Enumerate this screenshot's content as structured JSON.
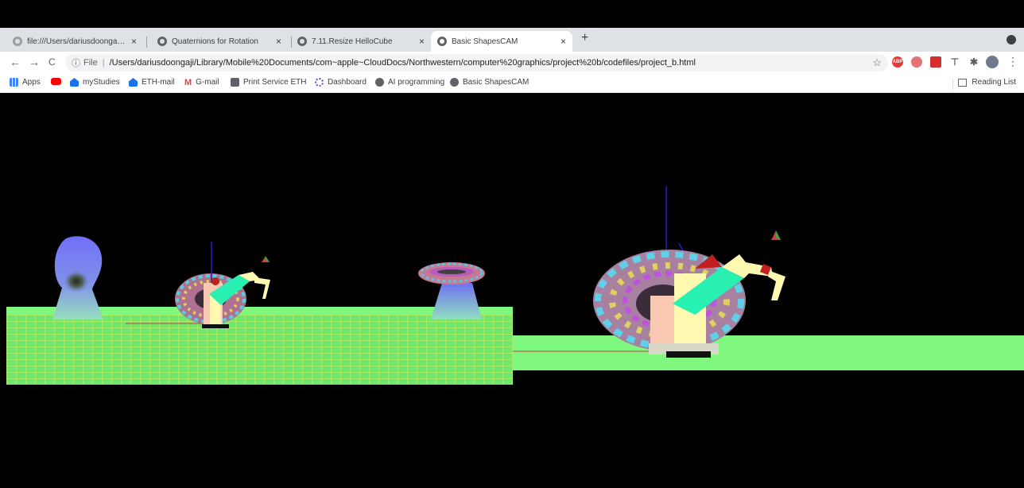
{
  "tabs": [
    {
      "label": "file:///Users/dariusdoongaji/Libr",
      "icon": "file-icon"
    },
    {
      "label": "Quaternions for Rotation",
      "icon": "globe-icon"
    },
    {
      "label": "7.11.Resize HelloCube",
      "icon": "globe-icon"
    },
    {
      "label": "Basic ShapesCAM",
      "icon": "globe-icon",
      "active": true
    }
  ],
  "toolbar": {
    "back": "←",
    "forward": "→",
    "reload": "C",
    "scheme_label": "File",
    "url": "/Users/dariusdoongaji/Library/Mobile%20Documents/com~apple~CloudDocs/Northwestern/computer%20graphics/project%20b/codefiles/project_b.html",
    "star": "☆",
    "menu": "⋮"
  },
  "extensions": [
    {
      "name": "adblock-icon",
      "text": "ABP",
      "color": "#e53935"
    },
    {
      "name": "shield-extension-icon",
      "text": "",
      "color": "#e57373"
    },
    {
      "name": "pdf-extension-icon",
      "text": "",
      "color": "#d32f2f"
    },
    {
      "name": "pin-extension-icon",
      "text": "",
      "color": "#5f6368"
    },
    {
      "name": "puzzle-icon",
      "text": "",
      "color": "#5f6368"
    },
    {
      "name": "profile-avatar-icon",
      "text": "",
      "color": "#6d7b8d"
    }
  ],
  "bookmarks": [
    {
      "label": "Apps",
      "icon": "apps-grid-icon",
      "color": "#4285f4"
    },
    {
      "label": "",
      "icon": "youtube-icon",
      "color": "#ff0000"
    },
    {
      "label": "myStudies",
      "icon": "eth-building-icon",
      "color": "#1a73e8"
    },
    {
      "label": "ETH-mail",
      "icon": "eth-building-icon",
      "color": "#1a73e8"
    },
    {
      "label": "G-mail",
      "icon": "gmail-icon",
      "color": "#ea4335"
    },
    {
      "label": "Print Service ETH",
      "icon": "printer-icon",
      "color": "#5f6368"
    },
    {
      "label": "Dashboard",
      "icon": "dashboard-icon",
      "color": "#7b3fbf"
    },
    {
      "label": "AI programming",
      "icon": "globe-icon",
      "color": "#5f6368"
    },
    {
      "label": "Basic ShapesCAM",
      "icon": "globe-icon",
      "color": "#5f6368"
    }
  ],
  "reading_list": "Reading List",
  "colors": {
    "ground": "#80f880",
    "grid": "#d8f060",
    "torus_shadow": "#3a2c3a",
    "mint": "#28f0b0",
    "cream": "#fff8b0",
    "skin": "#f8c8b0",
    "blob_top": "#7878f0",
    "blob_bottom": "#90d8c8"
  }
}
